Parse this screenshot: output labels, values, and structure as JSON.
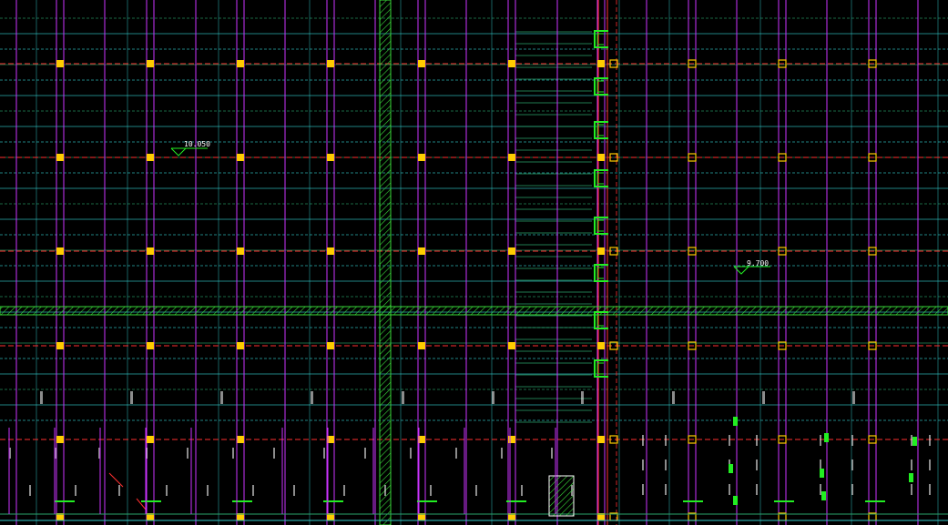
{
  "drawing": {
    "background": "#000000",
    "colors": {
      "column_line": "#cc33ff",
      "grid_red": "#ff3030",
      "grid_cyan": "#33cccc",
      "grid_green": "#2aa36b",
      "column": "#ffcc00",
      "band": "#39d939",
      "bracket": "#22ee22",
      "dim_text": "#ffffff"
    },
    "elevation_markers": [
      {
        "label": "10.050"
      },
      {
        "label": "9.700"
      }
    ]
  }
}
